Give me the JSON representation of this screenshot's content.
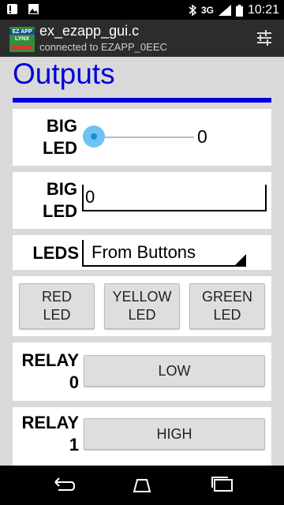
{
  "status_bar": {
    "network": "3G",
    "time": "10:21"
  },
  "app_bar": {
    "logo_line1": "EZ APP",
    "logo_line2": "LYNX",
    "title": "ex_ezapp_gui.c",
    "subtitle": "connected to EZAPP_0EEC"
  },
  "main": {
    "title": "Outputs",
    "big_led_slider": {
      "label_line1": "BIG",
      "label_line2": "LED",
      "value": "0",
      "level": 0
    },
    "big_led_text": {
      "label_line1": "BIG",
      "label_line2": "LED",
      "value": "0"
    },
    "leds_select": {
      "label": "LEDS",
      "selected": "From Buttons"
    },
    "led_buttons": [
      {
        "line1": "RED",
        "line2": "LED"
      },
      {
        "line1": "YELLOW",
        "line2": "LED"
      },
      {
        "line1": "GREEN",
        "line2": "LED"
      }
    ],
    "relay0": {
      "label_line1": "RELAY",
      "label_line2": "0",
      "state": "LOW"
    },
    "relay1": {
      "label_line1": "RELAY",
      "label_line2": "1",
      "state": "HIGH"
    }
  },
  "colors": {
    "accent": "#0000dd",
    "slider": "#6fc3f2"
  }
}
